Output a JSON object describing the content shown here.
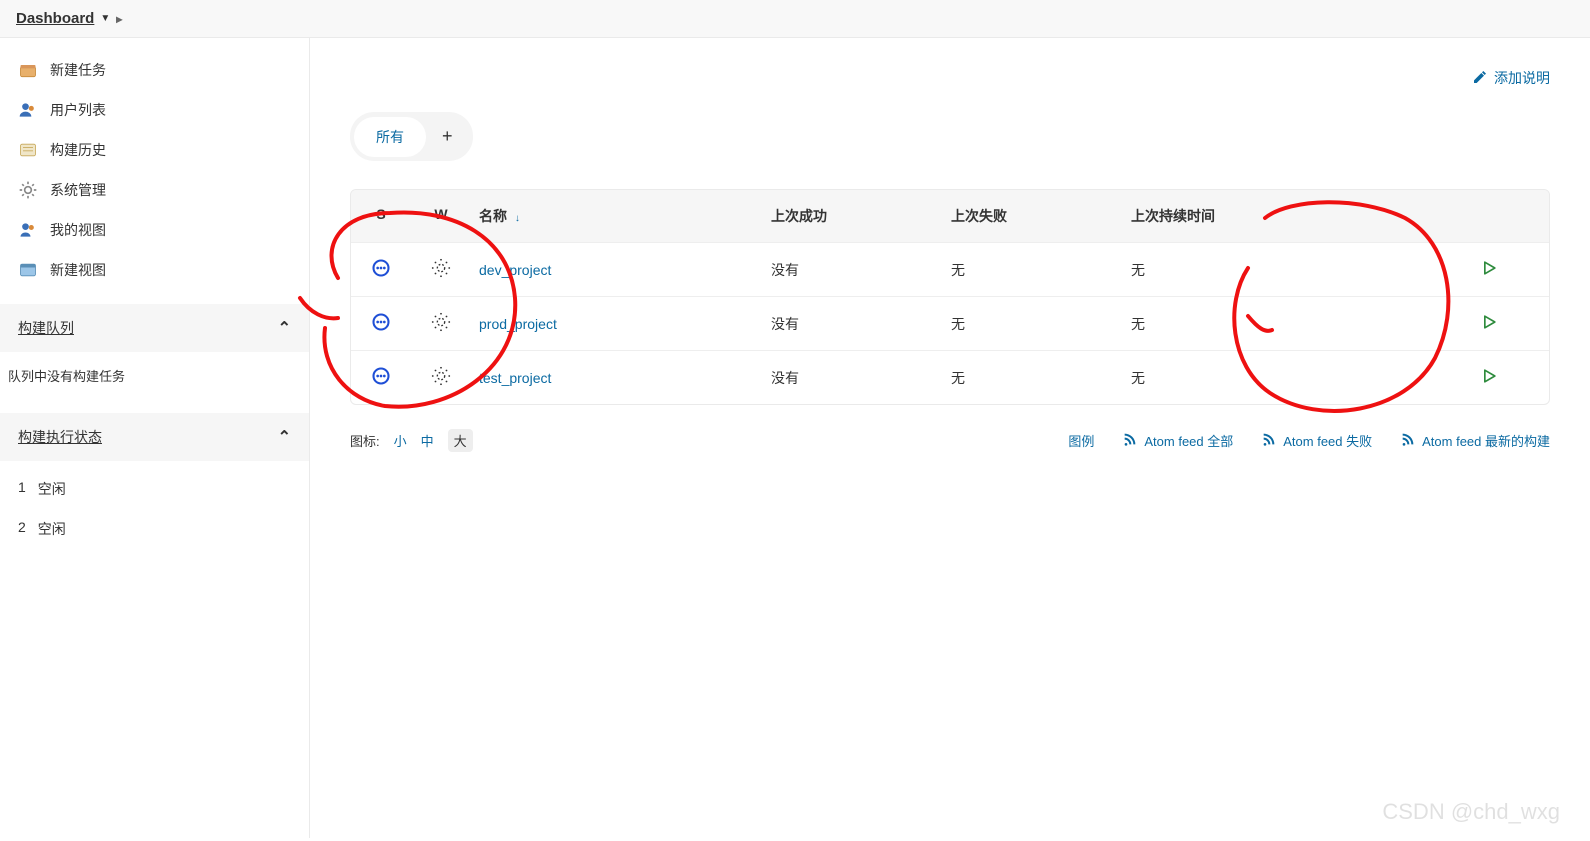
{
  "breadcrumb": {
    "label": "Dashboard"
  },
  "sidebar": {
    "tasks": [
      {
        "icon": "new-item",
        "label": "新建任务"
      },
      {
        "icon": "people",
        "label": "用户列表"
      },
      {
        "icon": "history",
        "label": "构建历史"
      },
      {
        "icon": "gear",
        "label": "系统管理"
      },
      {
        "icon": "my-views",
        "label": "我的视图"
      },
      {
        "icon": "new-view",
        "label": "新建视图"
      }
    ],
    "queue": {
      "title": "构建队列",
      "empty_text": "队列中没有构建任务"
    },
    "executors": {
      "title": "构建执行状态",
      "items": [
        {
          "num": "1",
          "status": "空闲"
        },
        {
          "num": "2",
          "status": "空闲"
        }
      ]
    }
  },
  "main": {
    "add_description": "添加说明",
    "tabs": {
      "all": "所有"
    },
    "columns": {
      "s": "S",
      "w": "W",
      "name": "名称",
      "last_success": "上次成功",
      "last_fail": "上次失败",
      "duration": "上次持续时间"
    },
    "jobs": [
      {
        "name": "dev_project",
        "last_success": "没有",
        "last_fail": "无",
        "duration": "无"
      },
      {
        "name": "prod_project",
        "last_success": "没有",
        "last_fail": "无",
        "duration": "无"
      },
      {
        "name": "test_project",
        "last_success": "没有",
        "last_fail": "无",
        "duration": "无"
      }
    ],
    "footer": {
      "icon_label": "图标:",
      "sizes": {
        "small": "小",
        "medium": "中",
        "large": "大"
      },
      "legend": "图例",
      "feed_all": "Atom feed 全部",
      "feed_fail": "Atom feed 失败",
      "feed_latest": "Atom feed 最新的构建"
    }
  },
  "watermark": "CSDN @chd_wxg"
}
